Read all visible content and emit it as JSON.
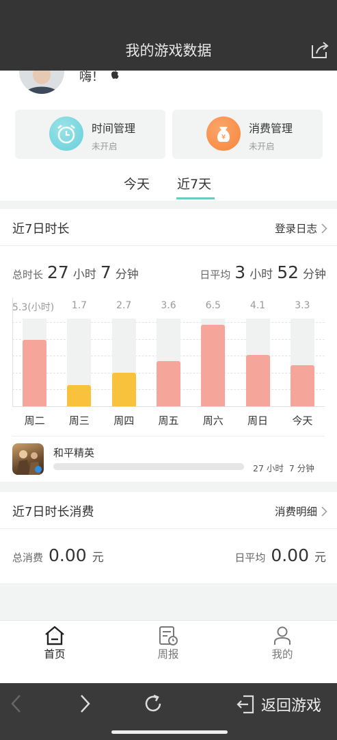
{
  "header": {
    "title": "我的游戏数据",
    "share_icon": "share-icon"
  },
  "profile": {
    "greeting": "嗨！"
  },
  "cards": [
    {
      "title": "时间管理",
      "status": "未开启",
      "icon": "alarm-clock-icon",
      "color": "#66cfd8"
    },
    {
      "title": "消费管理",
      "status": "未开启",
      "icon": "money-bag-icon",
      "color": "#f7853a"
    }
  ],
  "tabs": [
    {
      "label": "今天"
    },
    {
      "label": "近7天"
    }
  ],
  "duration": {
    "title": "近7日时长",
    "link": "登录日志",
    "total_label": "总时长",
    "total_hours": "27",
    "hours_unit": "小时",
    "total_minutes": "7",
    "minutes_unit": "分钟",
    "avg_label": "日平均",
    "avg_hours": "3",
    "avg_minutes": "52"
  },
  "chart_data": {
    "type": "bar",
    "categories": [
      "周二",
      "周三",
      "周四",
      "周五",
      "周六",
      "周日",
      "今天"
    ],
    "values": [
      5.3,
      1.7,
      2.7,
      3.6,
      6.5,
      4.1,
      3.3
    ],
    "value_labels": [
      "5.3(小时)",
      "1.7",
      "2.7",
      "3.6",
      "6.5",
      "4.1",
      "3.3"
    ],
    "ylim": [
      0,
      7
    ],
    "colors": [
      "#f6a59b",
      "#f8c23c",
      "#f8c23c",
      "#f6a59b",
      "#f6a59b",
      "#f6a59b",
      "#f6a59b"
    ],
    "grid": true
  },
  "game": {
    "name": "和平精英",
    "time": "27 小时  7 分钟",
    "progress": 1.0
  },
  "spend": {
    "title": "近7日时长消费",
    "link": "消费明细",
    "total_label": "总消费",
    "total_value": "0.00",
    "unit": "元",
    "avg_label": "日平均",
    "avg_value": "0.00"
  },
  "bottom_nav": [
    {
      "label": "首页",
      "icon": "home-icon",
      "active": true
    },
    {
      "label": "周报",
      "icon": "report-icon",
      "active": false
    },
    {
      "label": "我的",
      "icon": "profile-icon",
      "active": false
    }
  ],
  "browser": {
    "return_label": "返回游戏"
  }
}
